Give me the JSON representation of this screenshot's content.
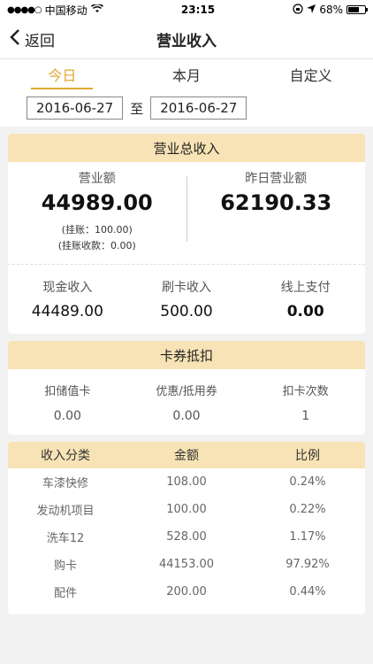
{
  "status": {
    "carrier": "中国移动",
    "time": "23:15",
    "battery": "68%",
    "battery_level": 0.68
  },
  "nav": {
    "back_label": "返回",
    "title": "营业收入"
  },
  "tabs": [
    {
      "label": "今日",
      "active": true
    },
    {
      "label": "本月",
      "active": false
    },
    {
      "label": "自定义",
      "active": false
    }
  ],
  "date_range": {
    "start": "2016-06-27",
    "sep": "至",
    "end": "2016-06-27"
  },
  "total": {
    "header": "营业总收入",
    "revenue_label": "营业额",
    "revenue_value": "44989.00",
    "on_account": "(挂账：100.00)",
    "on_account_received": "(挂账收款：0.00)",
    "yesterday_label": "昨日营业额",
    "yesterday_value": "62190.33",
    "cash_label": "现金收入",
    "cash_value": "44489.00",
    "card_label": "刷卡收入",
    "card_value": "500.00",
    "online_label": "线上支付",
    "online_value": "0.00"
  },
  "coupons": {
    "header": "卡券抵扣",
    "items": [
      {
        "label": "扣储值卡",
        "value": "0.00"
      },
      {
        "label": "优惠/抵用券",
        "value": "0.00"
      },
      {
        "label": "扣卡次数",
        "value": "1"
      }
    ]
  },
  "breakdown": {
    "headers": [
      "收入分类",
      "金额",
      "比例"
    ],
    "rows": [
      [
        "车漆快修",
        "108.00",
        "0.24%"
      ],
      [
        "发动机项目",
        "100.00",
        "0.22%"
      ],
      [
        "洗车12",
        "528.00",
        "1.17%"
      ],
      [
        "购卡",
        "44153.00",
        "97.92%"
      ],
      [
        "配件",
        "200.00",
        "0.44%"
      ]
    ]
  },
  "colors": {
    "accent": "#e0a92c",
    "header_bg": "#f7e3b5"
  }
}
